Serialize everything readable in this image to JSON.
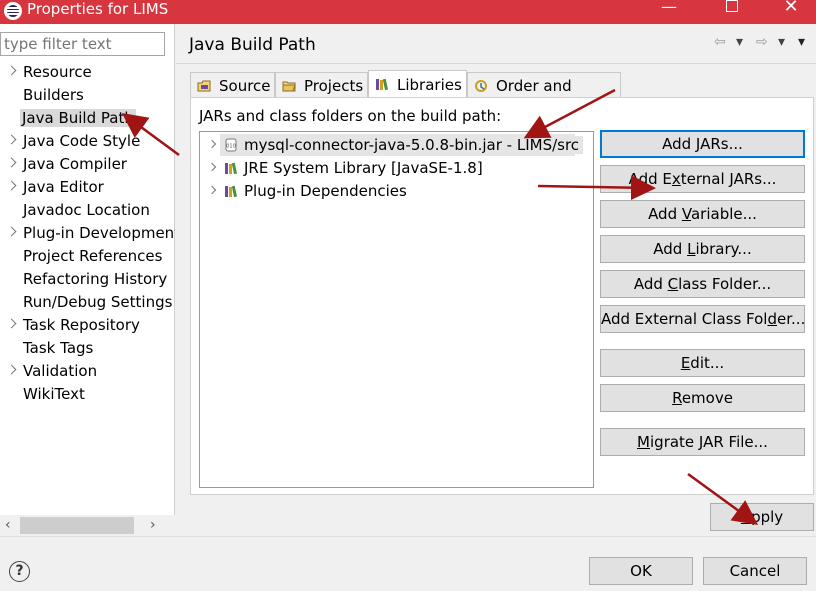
{
  "window": {
    "title": "Properties for LIMS",
    "controls": {
      "minimize": "—",
      "maximize": "",
      "close": "✕"
    }
  },
  "sidebar": {
    "filter_placeholder": "type filter text",
    "items": [
      {
        "label": "Resource",
        "expandable": true
      },
      {
        "label": "Builders",
        "expandable": false
      },
      {
        "label": "Java Build Path",
        "expandable": false,
        "selected": true
      },
      {
        "label": "Java Code Style",
        "expandable": true
      },
      {
        "label": "Java Compiler",
        "expandable": true
      },
      {
        "label": "Java Editor",
        "expandable": true
      },
      {
        "label": "Javadoc Location",
        "expandable": false
      },
      {
        "label": "Plug-in Development",
        "expandable": true
      },
      {
        "label": "Project References",
        "expandable": false
      },
      {
        "label": "Refactoring History",
        "expandable": false
      },
      {
        "label": "Run/Debug Settings",
        "expandable": false
      },
      {
        "label": "Task Repository",
        "expandable": true
      },
      {
        "label": "Task Tags",
        "expandable": false
      },
      {
        "label": "Validation",
        "expandable": true
      },
      {
        "label": "WikiText",
        "expandable": false
      }
    ],
    "scroll_left": "‹",
    "scroll_right": "›"
  },
  "header": {
    "title": "Java Build Path",
    "nav": {
      "back": "⇦",
      "back_menu": "▾",
      "forward": "⇨",
      "forward_menu": "▾",
      "view_menu": "▾"
    }
  },
  "tabs": [
    {
      "label": "Source",
      "icon": "source-folder-icon"
    },
    {
      "label": "Projects",
      "icon": "projects-icon"
    },
    {
      "label": "Libraries",
      "icon": "libraries-icon",
      "active": true
    },
    {
      "label": "Order and Export",
      "icon": "order-export-icon"
    }
  ],
  "libraries": {
    "heading": "JARs and class folders on the build path:",
    "entries": [
      {
        "label": "mysql-connector-java-5.0.8-bin.jar - LIMS/src",
        "icon": "jar-icon",
        "selected": true
      },
      {
        "label": "JRE System Library [JavaSE-1.8]",
        "icon": "library-icon"
      },
      {
        "label": "Plug-in Dependencies",
        "icon": "library-icon"
      }
    ]
  },
  "buttons": {
    "add_jars": {
      "pre": "Add ",
      "u": "J",
      "post": "ARs..."
    },
    "add_external_jars": {
      "pre": "Add E",
      "u": "x",
      "post": "ternal JARs..."
    },
    "add_variable": {
      "pre": "Add ",
      "u": "V",
      "post": "ariable..."
    },
    "add_library": {
      "pre": "Add ",
      "u": "L",
      "post": "ibrary..."
    },
    "add_class_folder": {
      "pre": "Add ",
      "u": "C",
      "post": "lass Folder..."
    },
    "add_external_class_folder": {
      "pre": "Add External Class Fol",
      "u": "d",
      "post": "er..."
    },
    "edit": {
      "pre": "",
      "u": "E",
      "post": "dit..."
    },
    "remove": {
      "pre": "",
      "u": "R",
      "post": "emove"
    },
    "migrate": {
      "pre": "",
      "u": "M",
      "post": "igrate JAR File..."
    },
    "apply": {
      "pre": "",
      "u": "A",
      "post": "pply"
    },
    "ok": "OK",
    "cancel": "Cancel"
  },
  "help": {
    "label": "?"
  },
  "colors": {
    "titlebar": "#d7363e",
    "arrow": "#a01414",
    "focus": "#0078d7"
  }
}
